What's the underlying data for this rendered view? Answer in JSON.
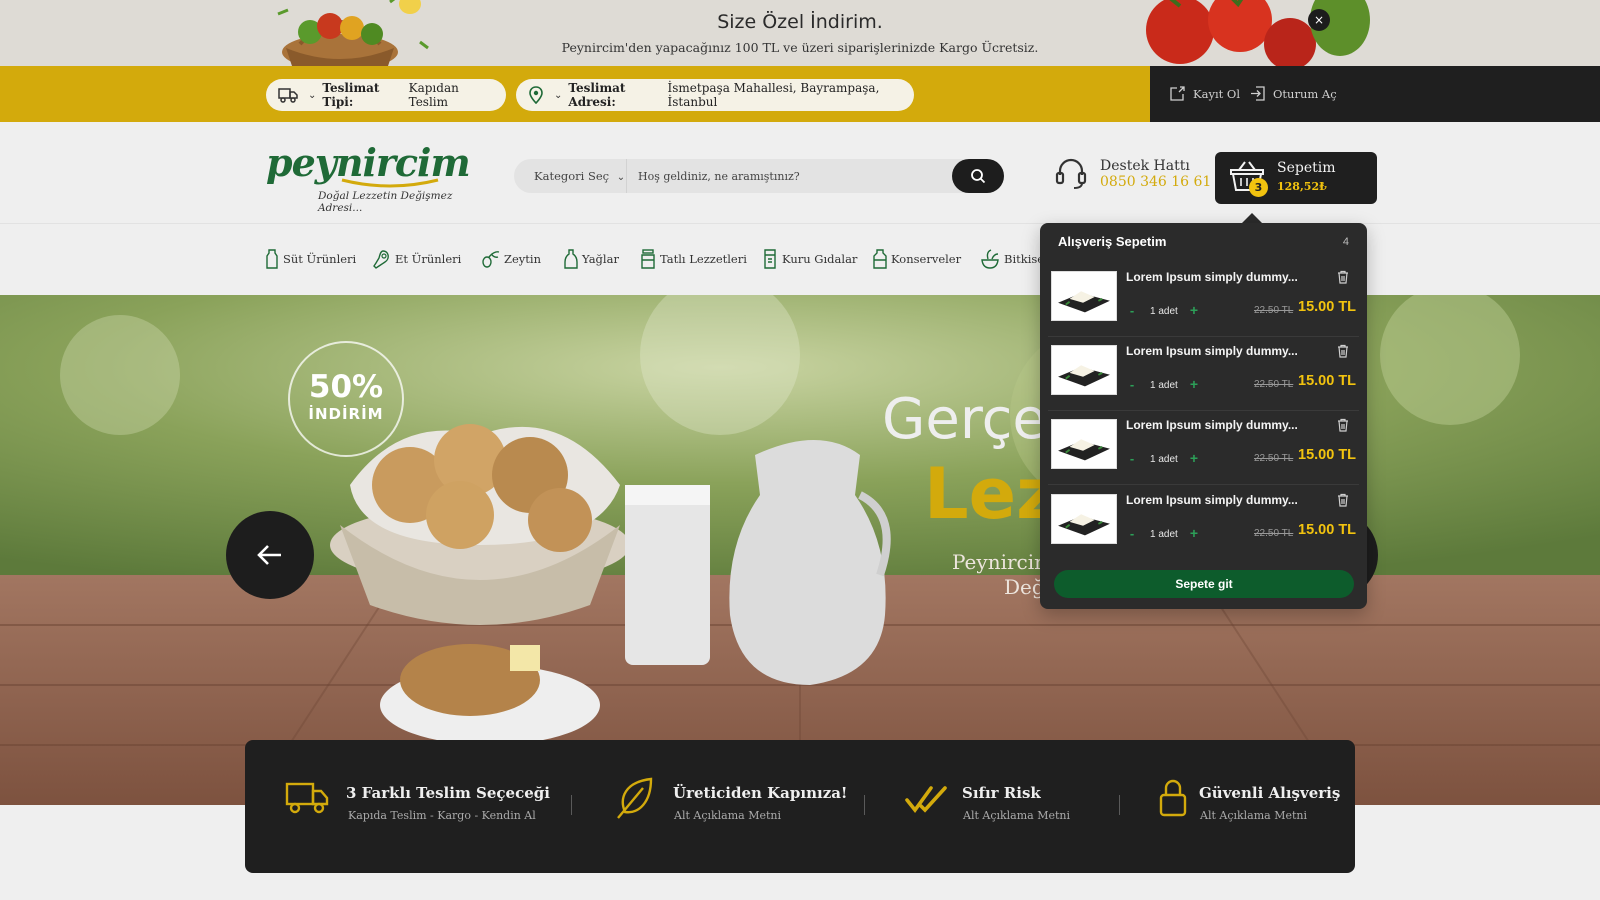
{
  "promo": {
    "title": "Size Özel İndirim.",
    "subtitle": "Peynircim'den yapacağınız 100 TL ve üzeri siparişlerinizde Kargo Ücretsiz.",
    "close_label": "×"
  },
  "delivery": {
    "type_label": "Teslimat Tipi:",
    "type_value": "Kapıdan Teslim",
    "address_label": "Teslimat Adresi:",
    "address_value": "İsmetpaşa Mahallesi, Bayrampaşa, İstanbul"
  },
  "account": {
    "register": "Kayıt Ol",
    "login": "Oturum Aç"
  },
  "brand": {
    "name": "peynircim",
    "tagline": "Doğal Lezzetin Değişmez Adresi..."
  },
  "search": {
    "category_label": "Kategori Seç",
    "placeholder": "Hoş geldiniz, ne aramıştınız?"
  },
  "support": {
    "label": "Destek Hattı",
    "phone": "0850 346 16 61"
  },
  "cart": {
    "label": "Sepetim",
    "total": "128,52₺",
    "count": "3"
  },
  "categories": [
    {
      "label": "Süt Ürünleri",
      "icon": "milk-bottle-icon"
    },
    {
      "label": "Et Ürünleri",
      "icon": "meat-icon"
    },
    {
      "label": "Zeytin",
      "icon": "olive-icon"
    },
    {
      "label": "Yağlar",
      "icon": "oil-bottle-icon"
    },
    {
      "label": "Tatlı Lezzetleri",
      "icon": "honey-jar-icon"
    },
    {
      "label": "Kuru Gıdalar",
      "icon": "sack-icon"
    },
    {
      "label": "Konserveler",
      "icon": "jar-icon"
    },
    {
      "label": "Bitkisel",
      "icon": "herb-bowl-icon"
    }
  ],
  "hero": {
    "badge_percent": "50%",
    "badge_label": "İNDİRİM",
    "heading_line1": "Gerçek",
    "heading_line2": "Lez",
    "text_line1": "Peynircim",
    "text_line2": "Değ"
  },
  "features": [
    {
      "title": "3 Farklı Teslim Seçeceği",
      "desc": "Kapıda Teslim - Kargo - Kendin Al",
      "icon": "truck-icon"
    },
    {
      "title": "Üreticiden Kapınıza!",
      "desc": "Alt Açıklama Metni",
      "icon": "leaf-icon"
    },
    {
      "title": "Sıfır Risk",
      "desc": "Alt Açıklama Metni",
      "icon": "double-check-icon"
    },
    {
      "title": "Güvenli Alışveriş",
      "desc": "Alt Açıklama Metni",
      "icon": "lock-icon"
    }
  ],
  "cart_dropdown": {
    "title": "Alışveriş Sepetim",
    "count": "4",
    "items": [
      {
        "name": "Lorem Ipsum simply dummy...",
        "qty": "1 adet",
        "old_price": "22.50 TL",
        "price": "15.00 TL"
      },
      {
        "name": "Lorem Ipsum simply dummy...",
        "qty": "1 adet",
        "old_price": "22.50 TL",
        "price": "15.00 TL"
      },
      {
        "name": "Lorem Ipsum simply dummy...",
        "qty": "1 adet",
        "old_price": "22.50 TL",
        "price": "15.00 TL"
      },
      {
        "name": "Lorem Ipsum simply dummy...",
        "qty": "1 adet",
        "old_price": "22.50 TL",
        "price": "15.00 TL"
      }
    ],
    "minus_label": "-",
    "plus_label": "+",
    "button": "Sepete git"
  },
  "colors": {
    "accent_yellow": "#d3aa0c",
    "brand_green": "#1f6a37",
    "dark": "#1f1f1f",
    "cart_button_green": "#0d5c2c"
  }
}
